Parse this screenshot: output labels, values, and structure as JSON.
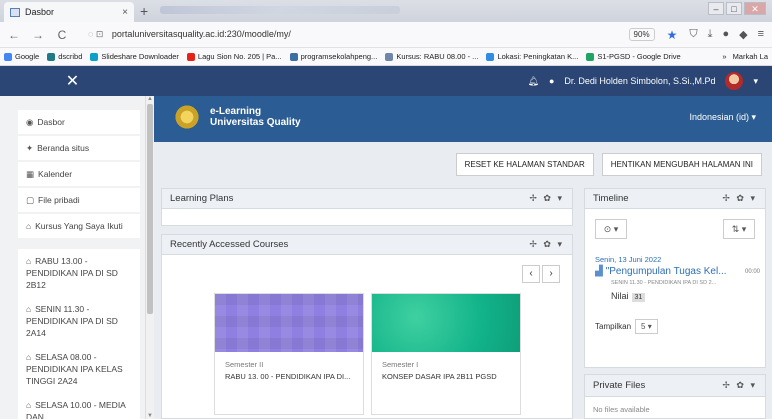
{
  "browser": {
    "tab_title": "Dasbor",
    "tab_close": "×",
    "new_tab": "+",
    "url": "portaluniversitasquality.ac.id:230/moodle/my/",
    "zoom": "90%",
    "back": "←",
    "forward": "→",
    "reload": "C",
    "bookmarks": [
      {
        "label": "Google",
        "color": "#4285f4"
      },
      {
        "label": "dscribd",
        "color": "#1e7b85"
      },
      {
        "label": "Slideshare Downloader",
        "color": "#0aa0c9"
      },
      {
        "label": "Lagu Sion No. 205 | Pa...",
        "color": "#e62117"
      },
      {
        "label": "programsekolahpeng...",
        "color": "#3a6ea5"
      },
      {
        "label": "Kursus: RABU 08.00 - ...",
        "color": "#6f86a8"
      },
      {
        "label": "Lokasi: Peningkatan K...",
        "color": "#2f8de4"
      },
      {
        "label": "S1-PGSD - Google Drive",
        "color": "#1fa463"
      }
    ],
    "bookmarks_more": "»",
    "bookmarks_other": "Markah La"
  },
  "topbar": {
    "menu_icon": "✕",
    "user_name": "Dr. Dedi Holden Simbolon, S.Si.,M.Pd",
    "caret": "▾"
  },
  "drawer": {
    "items": [
      {
        "icon": "◉",
        "label": "Dasbor"
      },
      {
        "icon": "✦",
        "label": "Beranda situs"
      },
      {
        "icon": "▦",
        "label": "Kalender"
      },
      {
        "icon": "▢",
        "label": "File pribadi"
      },
      {
        "icon": "⌂",
        "label": "Kursus Yang Saya Ikuti"
      },
      {
        "icon": "⌂",
        "label": "RABU 13.00 - PENDIDIKAN IPA DI SD 2B12"
      },
      {
        "icon": "⌂",
        "label": "SENIN 11.30 - PENDIDIKAN IPA DI SD 2A14"
      },
      {
        "icon": "⌂",
        "label": "SELASA 08.00 - PENDIDIKAN IPA KELAS TINGGI 2A24"
      },
      {
        "icon": "⌂",
        "label": "SELASA 10.00 - MEDIA DAN"
      }
    ]
  },
  "banner": {
    "logo_line1": "e-Learning",
    "logo_line2": "Universitas Quality",
    "language": "Indonesian (id) ▾"
  },
  "buttons": {
    "reset": "RESET KE HALAMAN STANDAR",
    "stop": "HENTIKAN MENGUBAH HALAMAN INI"
  },
  "blocks": {
    "tools": "✢ ✿ ▾",
    "learning_plans": "Learning Plans",
    "recent": "Recently Accessed Courses",
    "timeline": "Timeline",
    "private_files": "Private Files",
    "private_files_body": "No files available"
  },
  "recent_nav": {
    "prev": "‹",
    "next": "›"
  },
  "courses": [
    {
      "semester": "Semester II",
      "name": "RABU 13. 00 - PENDIDIKAN IPA DI..."
    },
    {
      "semester": "Semester I",
      "name": "KONSEP DASAR IPA 2B11 PGSD"
    }
  ],
  "timeline": {
    "filter_icon": "⊙ ▾",
    "sort_icon": "⇅ ▾",
    "date": "Senin, 13 Juni 2022",
    "event_name": "\"Pengumpulan Tugas Kel...",
    "event_time": "00:00",
    "event_course": "SENIN 11.30 - PENDIDIKAN IPA DI SD 2...",
    "grade_label": "Nilai",
    "grade_value": "31",
    "show_label": "Tampilkan",
    "show_value": "5 ▾"
  }
}
